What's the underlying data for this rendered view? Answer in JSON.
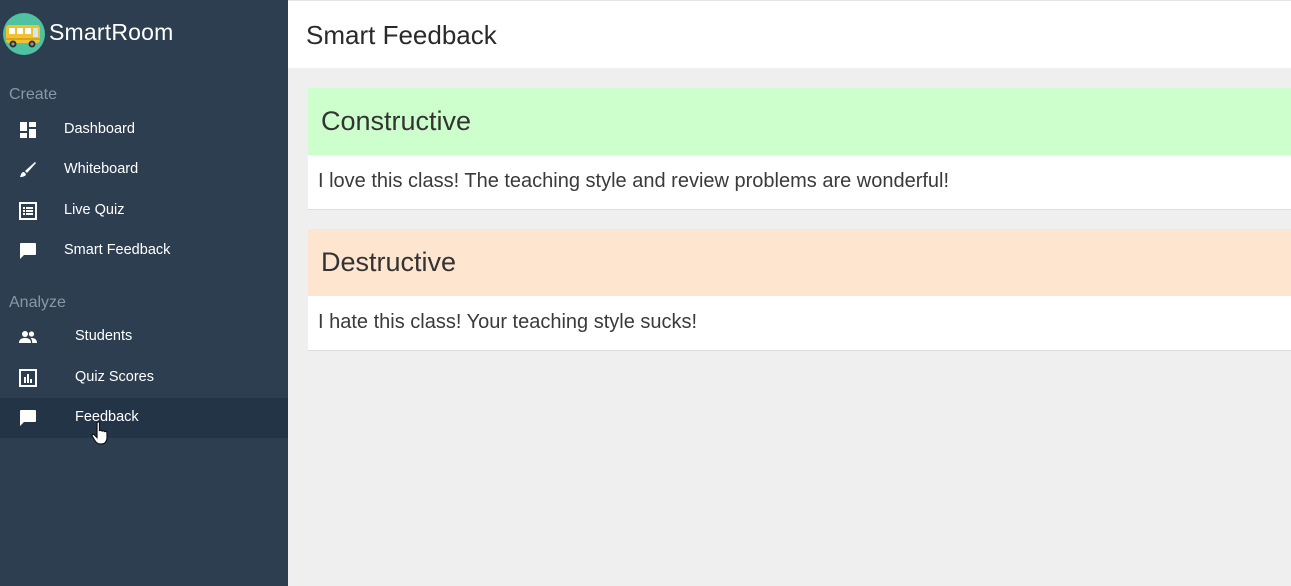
{
  "app": {
    "name": "SmartRoom"
  },
  "sidebar": {
    "sections": [
      {
        "label": "Create",
        "items": [
          {
            "label": "Dashboard",
            "icon": "dashboard-icon"
          },
          {
            "label": "Whiteboard",
            "icon": "brush-icon"
          },
          {
            "label": "Live Quiz",
            "icon": "list-icon"
          },
          {
            "label": "Smart Feedback",
            "icon": "chat-icon"
          }
        ]
      },
      {
        "label": "Analyze",
        "items": [
          {
            "label": "Students",
            "icon": "people-icon"
          },
          {
            "label": "Quiz Scores",
            "icon": "bar-chart-icon"
          },
          {
            "label": "Feedback",
            "icon": "chat-icon",
            "active": true
          }
        ]
      }
    ]
  },
  "header": {
    "title": "Smart Feedback"
  },
  "cards": [
    {
      "title": "Constructive",
      "text": "I love this class! The teaching style and review problems are wonderful!",
      "color": "#ccffcc"
    },
    {
      "title": "Destructive",
      "text": "I hate this class! Your teaching style sucks!",
      "color": "#fde5d0"
    }
  ],
  "colors": {
    "sidebar_bg": "#2c3e50",
    "sidebar_active_bg": "#243447",
    "content_bg": "#efefef"
  }
}
